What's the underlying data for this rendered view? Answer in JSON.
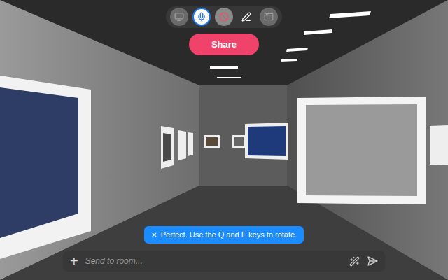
{
  "toolbar": {
    "buttons": [
      {
        "kind": "screen",
        "selected": false,
        "disabled": true
      },
      {
        "kind": "mic",
        "selected": true,
        "disabled": false
      },
      {
        "kind": "camera-off",
        "selected": false,
        "disabled": false
      },
      {
        "kind": "pen",
        "selected": false,
        "disabled": false
      },
      {
        "kind": "layout",
        "selected": false,
        "disabled": true
      }
    ]
  },
  "share_button": {
    "label": "Share"
  },
  "toast": {
    "close": "✕",
    "message": "Perfect. Use the Q and E keys to rotate."
  },
  "chat": {
    "add": "+",
    "placeholder": "Send to room..."
  }
}
